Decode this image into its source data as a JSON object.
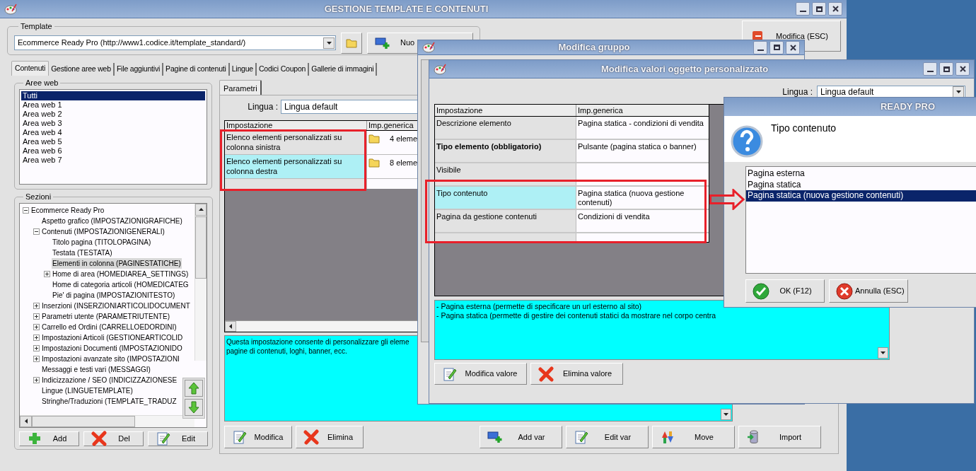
{
  "main_window": {
    "title": "GESTIONE TEMPLATE E CONTENUTI",
    "template": {
      "label": "Template",
      "value": "Ecommerce Ready Pro (http://www1.codice.it/template_standard/)",
      "new_button": "Nuo"
    },
    "exit_button": "Modifica (ESC)",
    "tabs": [
      {
        "label": "Contenuti",
        "selected": true
      },
      {
        "label": "Gestione aree web",
        "selected": false
      },
      {
        "label": "File aggiuntivi",
        "selected": false
      },
      {
        "label": "Pagine di contenuti",
        "selected": false
      },
      {
        "label": "Lingue",
        "selected": false
      },
      {
        "label": "Codici Coupon",
        "selected": false
      },
      {
        "label": "Gallerie di immagini",
        "selected": false
      }
    ],
    "aree_web": {
      "label": "Aree web",
      "items": [
        {
          "label": "Tutti",
          "selected": true
        },
        {
          "label": "Area web 1",
          "selected": false
        },
        {
          "label": "Area web 2",
          "selected": false
        },
        {
          "label": "Area web 3",
          "selected": false
        },
        {
          "label": "Area web 4",
          "selected": false
        },
        {
          "label": "Area web 5",
          "selected": false
        },
        {
          "label": "Area web 6",
          "selected": false
        },
        {
          "label": "Area web 7",
          "selected": false
        }
      ]
    },
    "sezioni": {
      "label": "Sezioni",
      "tree": [
        {
          "label": "Ecommerce Ready Pro",
          "expanded": true,
          "selected": false,
          "children": [
            {
              "label": "Aspetto grafico (IMPOSTAZIONIGRAFICHE)",
              "selected": false
            },
            {
              "label": "Contenuti (IMPOSTAZIONIGENERALI)",
              "expanded": true,
              "selected": false,
              "children": [
                {
                  "label": "Titolo pagina (TITOLOPAGINA)",
                  "selected": false
                },
                {
                  "label": "Testata (TESTATA)",
                  "selected": false
                },
                {
                  "label": "Elementi in colonna (PAGINESTATICHE)",
                  "selected": true
                },
                {
                  "label": "Home di area (HOMEDIAREA_SETTINGS)",
                  "expanded": false,
                  "selected": false
                },
                {
                  "label": "Home di categoria articoli (HOMEDICATEG",
                  "selected": false
                },
                {
                  "label": "Pie' di pagina (IMPOSTAZIONITESTO)",
                  "selected": false
                }
              ]
            },
            {
              "label": "Inserzioni (INSERZIONIARTICOLIDOCUMENT",
              "expanded": false,
              "selected": false
            },
            {
              "label": "Parametri utente (PARAMETRIUTENTE)",
              "expanded": false,
              "selected": false
            },
            {
              "label": "Carrello ed Ordini (CARRELLOEDORDINI)",
              "expanded": false,
              "selected": false
            },
            {
              "label": "Impostazioni Articoli (GESTIONEARTICOLID",
              "expanded": false,
              "selected": false
            },
            {
              "label": "Impostazioni Documenti (IMPOSTAZIONIDO",
              "expanded": false,
              "selected": false
            },
            {
              "label": "Impostazioni avanzate sito (IMPOSTAZIONI",
              "expanded": false,
              "selected": false
            },
            {
              "label": "Messaggi e testi vari (MESSAGGI)",
              "selected": false
            },
            {
              "label": "Indicizzazione / SEO (INDICIZZAZIONESE",
              "expanded": false,
              "selected": false
            },
            {
              "label": "Lingue (LINGUETEMPLATE)",
              "selected": false
            },
            {
              "label": "Stringhe/Traduzioni (TEMPLATE_TRADUZ",
              "selected": false
            }
          ]
        }
      ],
      "buttons": [
        "Add",
        "Del",
        "Edit"
      ]
    },
    "parametri": {
      "tab": "Parametri",
      "lingua_label": "Lingua :",
      "lingua_value": "Lingua default",
      "columns": [
        "Impostazione",
        "Imp.generica"
      ],
      "rows": [
        {
          "setting": "Elenco elementi personalizzati su colonna sinistra",
          "value": "4 eleme",
          "highlighted": false
        },
        {
          "setting": "Elenco elementi personalizzati su colonna destra",
          "value": "8 eleme",
          "highlighted": true
        }
      ],
      "description": [
        "Questa impostazione consente di personalizzare gli eleme",
        "pagine di contenuti, loghi, banner, ecc."
      ],
      "left_buttons": [
        "Modifica",
        "Elimina"
      ],
      "right_buttons": [
        "Add var",
        "Edit var",
        "Move",
        "Import"
      ]
    }
  },
  "group_dialog": {
    "title": "Modifica gruppo"
  },
  "values_dialog": {
    "title": "Modifica valori oggetto personalizzato",
    "lingua_label": "Lingua :",
    "lingua_value": "Lingua default",
    "columns": [
      "Impostazione",
      "Imp.generica"
    ],
    "rows": [
      {
        "setting": "Descrizione elemento",
        "value": "Pagina statica - condizioni di vendita",
        "required": false,
        "highlighted": false
      },
      {
        "setting": "Tipo elemento (obbligatorio)",
        "value": "Pulsante (pagina statica o banner)",
        "required": true,
        "highlighted": false
      },
      {
        "setting": "Visibile",
        "required": false,
        "highlighted": false
      },
      {
        "setting": "Tipo contenuto",
        "value": "Pagina statica (nuova gestione contenuti)",
        "required": false,
        "highlighted": true
      },
      {
        "setting": "Pagina da gestione contenuti",
        "value": "Condizioni di vendita",
        "required": false,
        "highlighted": false
      }
    ],
    "description": [
      "- Pagina esterna (permette di specificare un url esterno al sito)",
      "- Pagina statica (permette di gestire dei contenuti statici da mostrare nel corpo centra"
    ],
    "buttons": [
      "Modifica valore",
      "Elimina valore"
    ]
  },
  "prompt_dialog": {
    "title": "READY PRO",
    "question": "Tipo contenuto",
    "options": [
      {
        "label": "Pagina esterna",
        "selected": false
      },
      {
        "label": "Pagina statica",
        "selected": false
      },
      {
        "label": "Pagina statica (nuova gestione contenuti)",
        "selected": true
      }
    ],
    "buttons": [
      "OK (F12)",
      "Annulla (ESC)"
    ]
  }
}
